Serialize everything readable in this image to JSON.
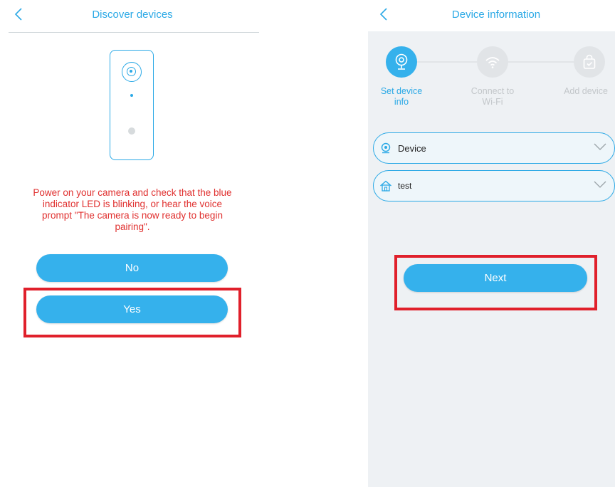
{
  "left": {
    "header": {
      "title": "Discover devices",
      "back_icon": "chevron-left-icon"
    },
    "instruction": "Power on your camera and check that the blue indicator LED is blinking, or hear the voice prompt \"The camera is now ready to begin pairing\".",
    "buttons": {
      "no_label": "No",
      "yes_label": "Yes"
    }
  },
  "right": {
    "header": {
      "title": "Device information",
      "back_icon": "chevron-left-icon"
    },
    "steps": [
      {
        "label_line1": "Set device",
        "label_line2": "info",
        "icon": "camera-icon",
        "state": "active"
      },
      {
        "label_line1": "Connect to",
        "label_line2": "Wi-Fi",
        "icon": "wifi-icon",
        "state": "inactive"
      },
      {
        "label_line1": "Add device",
        "label_line2": "",
        "icon": "bag-icon",
        "state": "inactive"
      }
    ],
    "device_select": {
      "value": "Device",
      "icon": "webcam-icon"
    },
    "room_select": {
      "value": "test",
      "icon": "home-icon"
    },
    "next_label": "Next"
  },
  "colors": {
    "accent": "#35b1ec",
    "title": "#2BA9E6",
    "warning_text": "#e0302f",
    "highlight": "#e0202b",
    "inactive": "#e1e4e7"
  }
}
